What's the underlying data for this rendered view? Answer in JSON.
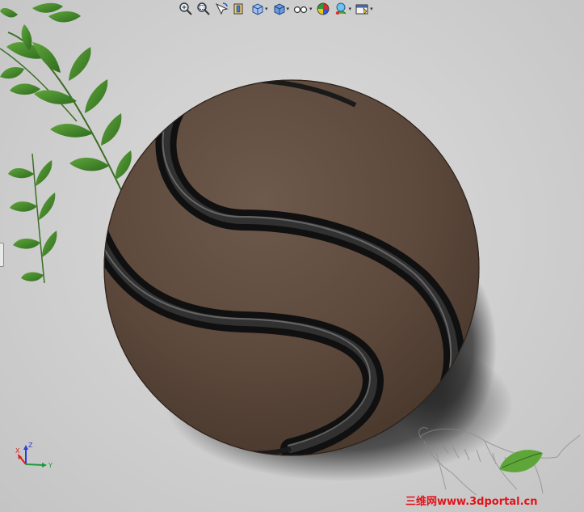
{
  "toolbar": {
    "items": [
      {
        "name": "zoom-to-fit",
        "icon": "zoom-to-fit-icon",
        "has_dropdown": false
      },
      {
        "name": "zoom-to-area",
        "icon": "zoom-to-area-icon",
        "has_dropdown": false
      },
      {
        "name": "previous-view",
        "icon": "previous-view-icon",
        "has_dropdown": false
      },
      {
        "name": "section-view",
        "icon": "section-view-icon",
        "has_dropdown": false
      },
      {
        "name": "view-orientation",
        "icon": "view-orientation-icon",
        "has_dropdown": true
      },
      {
        "name": "display-style",
        "icon": "display-style-icon",
        "has_dropdown": true
      },
      {
        "name": "hide-show-items",
        "icon": "hide-show-icon",
        "has_dropdown": true
      },
      {
        "name": "edit-appearance",
        "icon": "edit-appearance-icon",
        "has_dropdown": false
      },
      {
        "name": "apply-scene",
        "icon": "apply-scene-icon",
        "has_dropdown": true
      },
      {
        "name": "view-settings",
        "icon": "view-settings-icon",
        "has_dropdown": true
      }
    ],
    "caret": "▾"
  },
  "model": {
    "shape": "sphere-with-s-groove",
    "body_color": "#5e4a3d",
    "groove_color": "#1a1a1a"
  },
  "triad": {
    "x_label": "X",
    "y_label": "Y",
    "z_label": "Z",
    "x_color": "#d8201e",
    "y_color": "#1f9a3a",
    "z_color": "#2b3fd6"
  },
  "watermark": {
    "text": "三维网www.3dportal.cn",
    "color": "#e0141b"
  }
}
